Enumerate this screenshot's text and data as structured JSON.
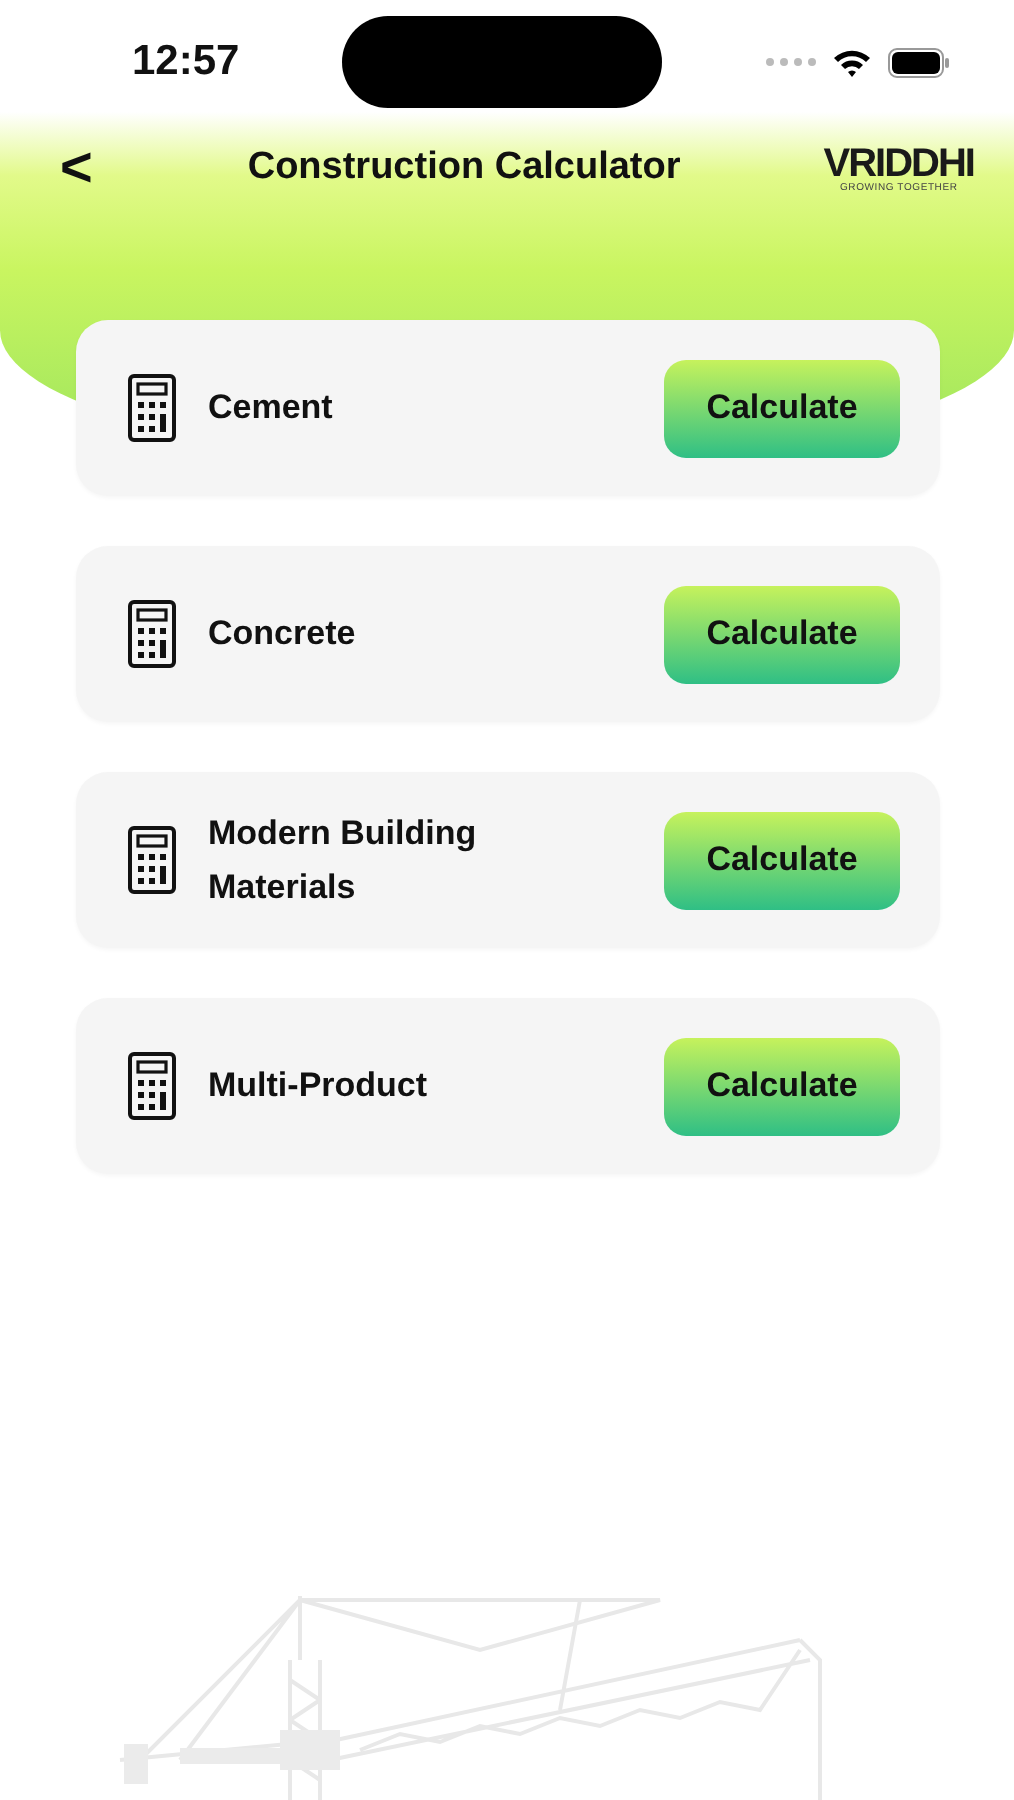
{
  "status_bar": {
    "time": "12:57"
  },
  "header": {
    "back": "<",
    "title": "Construction Calculator",
    "logo": {
      "name": "VRIDDHI",
      "tagline": "GROWING TOGETHER"
    }
  },
  "calculators": [
    {
      "label": "Cement",
      "button": "Calculate"
    },
    {
      "label": "Concrete",
      "button": "Calculate"
    },
    {
      "label": "Modern Building Materials",
      "button": "Calculate"
    },
    {
      "label": "Multi-Product",
      "button": "Calculate"
    }
  ]
}
